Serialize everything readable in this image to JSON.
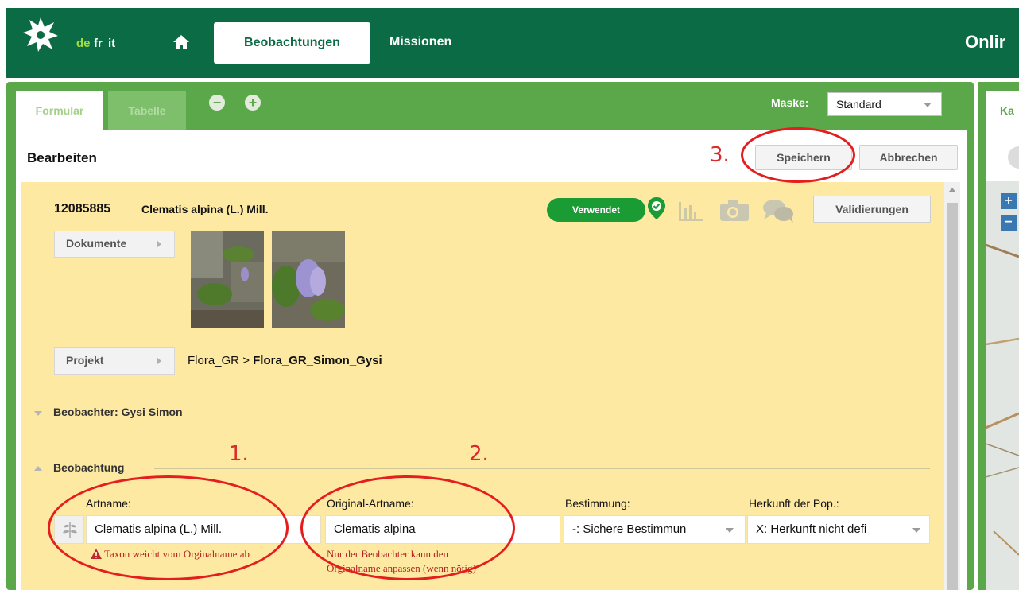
{
  "header": {
    "languages": [
      "de",
      "fr",
      "it"
    ],
    "active_language": "de",
    "tabs": [
      "Beobachtungen",
      "Missionen"
    ],
    "active_tab": "Beobachtungen",
    "title_partial": "Onlir"
  },
  "subtabs": {
    "form": "Formular",
    "table": "Tabelle"
  },
  "maske": {
    "label": "Maske:",
    "value": "Standard"
  },
  "edit": {
    "title": "Bearbeiten",
    "save": "Speichern",
    "cancel": "Abbrechen"
  },
  "observation": {
    "id": "12085885",
    "name": "Clematis alpina (L.) Mill.",
    "badge": "Verwendet",
    "validations_button": "Validierungen",
    "documents_button": "Dokumente",
    "project_button": "Projekt",
    "project_parent": "Flora_GR",
    "project_separator": ">",
    "project_child": "Flora_GR_Simon_Gysi"
  },
  "sections": {
    "observer": "Beobachter: Gysi Simon",
    "observation": "Beobachtung"
  },
  "fields": {
    "artname_label": "Artname:",
    "artname_value": "Clematis alpina (L.) Mill.",
    "original_label": "Original-Artname:",
    "original_value": "Clematis alpina",
    "bestimmung_label": "Bestimmung:",
    "bestimmung_value": "-: Sichere Bestimmun",
    "herkunft_label": "Herkunft der Pop.:",
    "herkunft_value": "X: Herkunft nicht defi"
  },
  "errors": {
    "taxon_warning": "Taxon weicht vom Orginalname ab",
    "original_note_line1": "Nur der Beobachter kann den",
    "original_note_line2": "Orginalname anpassen (wenn nötig)"
  },
  "annotations": {
    "step1": "1.",
    "step2": "2.",
    "step3": "3."
  },
  "right_panel": {
    "tab_partial": "Ka",
    "zoom_in": "+",
    "zoom_out": "−"
  },
  "colors": {
    "brand_green": "#0b6b45",
    "panel_green": "#5aa84a",
    "form_bg": "#fde9a2",
    "badge_green": "#1a9b33",
    "annotation_red": "#e41e1e"
  },
  "icons": [
    "logo-icon",
    "home-icon",
    "minus-circle-icon",
    "plus-circle-icon",
    "location-check-icon",
    "chart-icon",
    "camera-icon",
    "comments-icon",
    "taxon-leaf-icon",
    "warning-icon",
    "search-icon"
  ]
}
